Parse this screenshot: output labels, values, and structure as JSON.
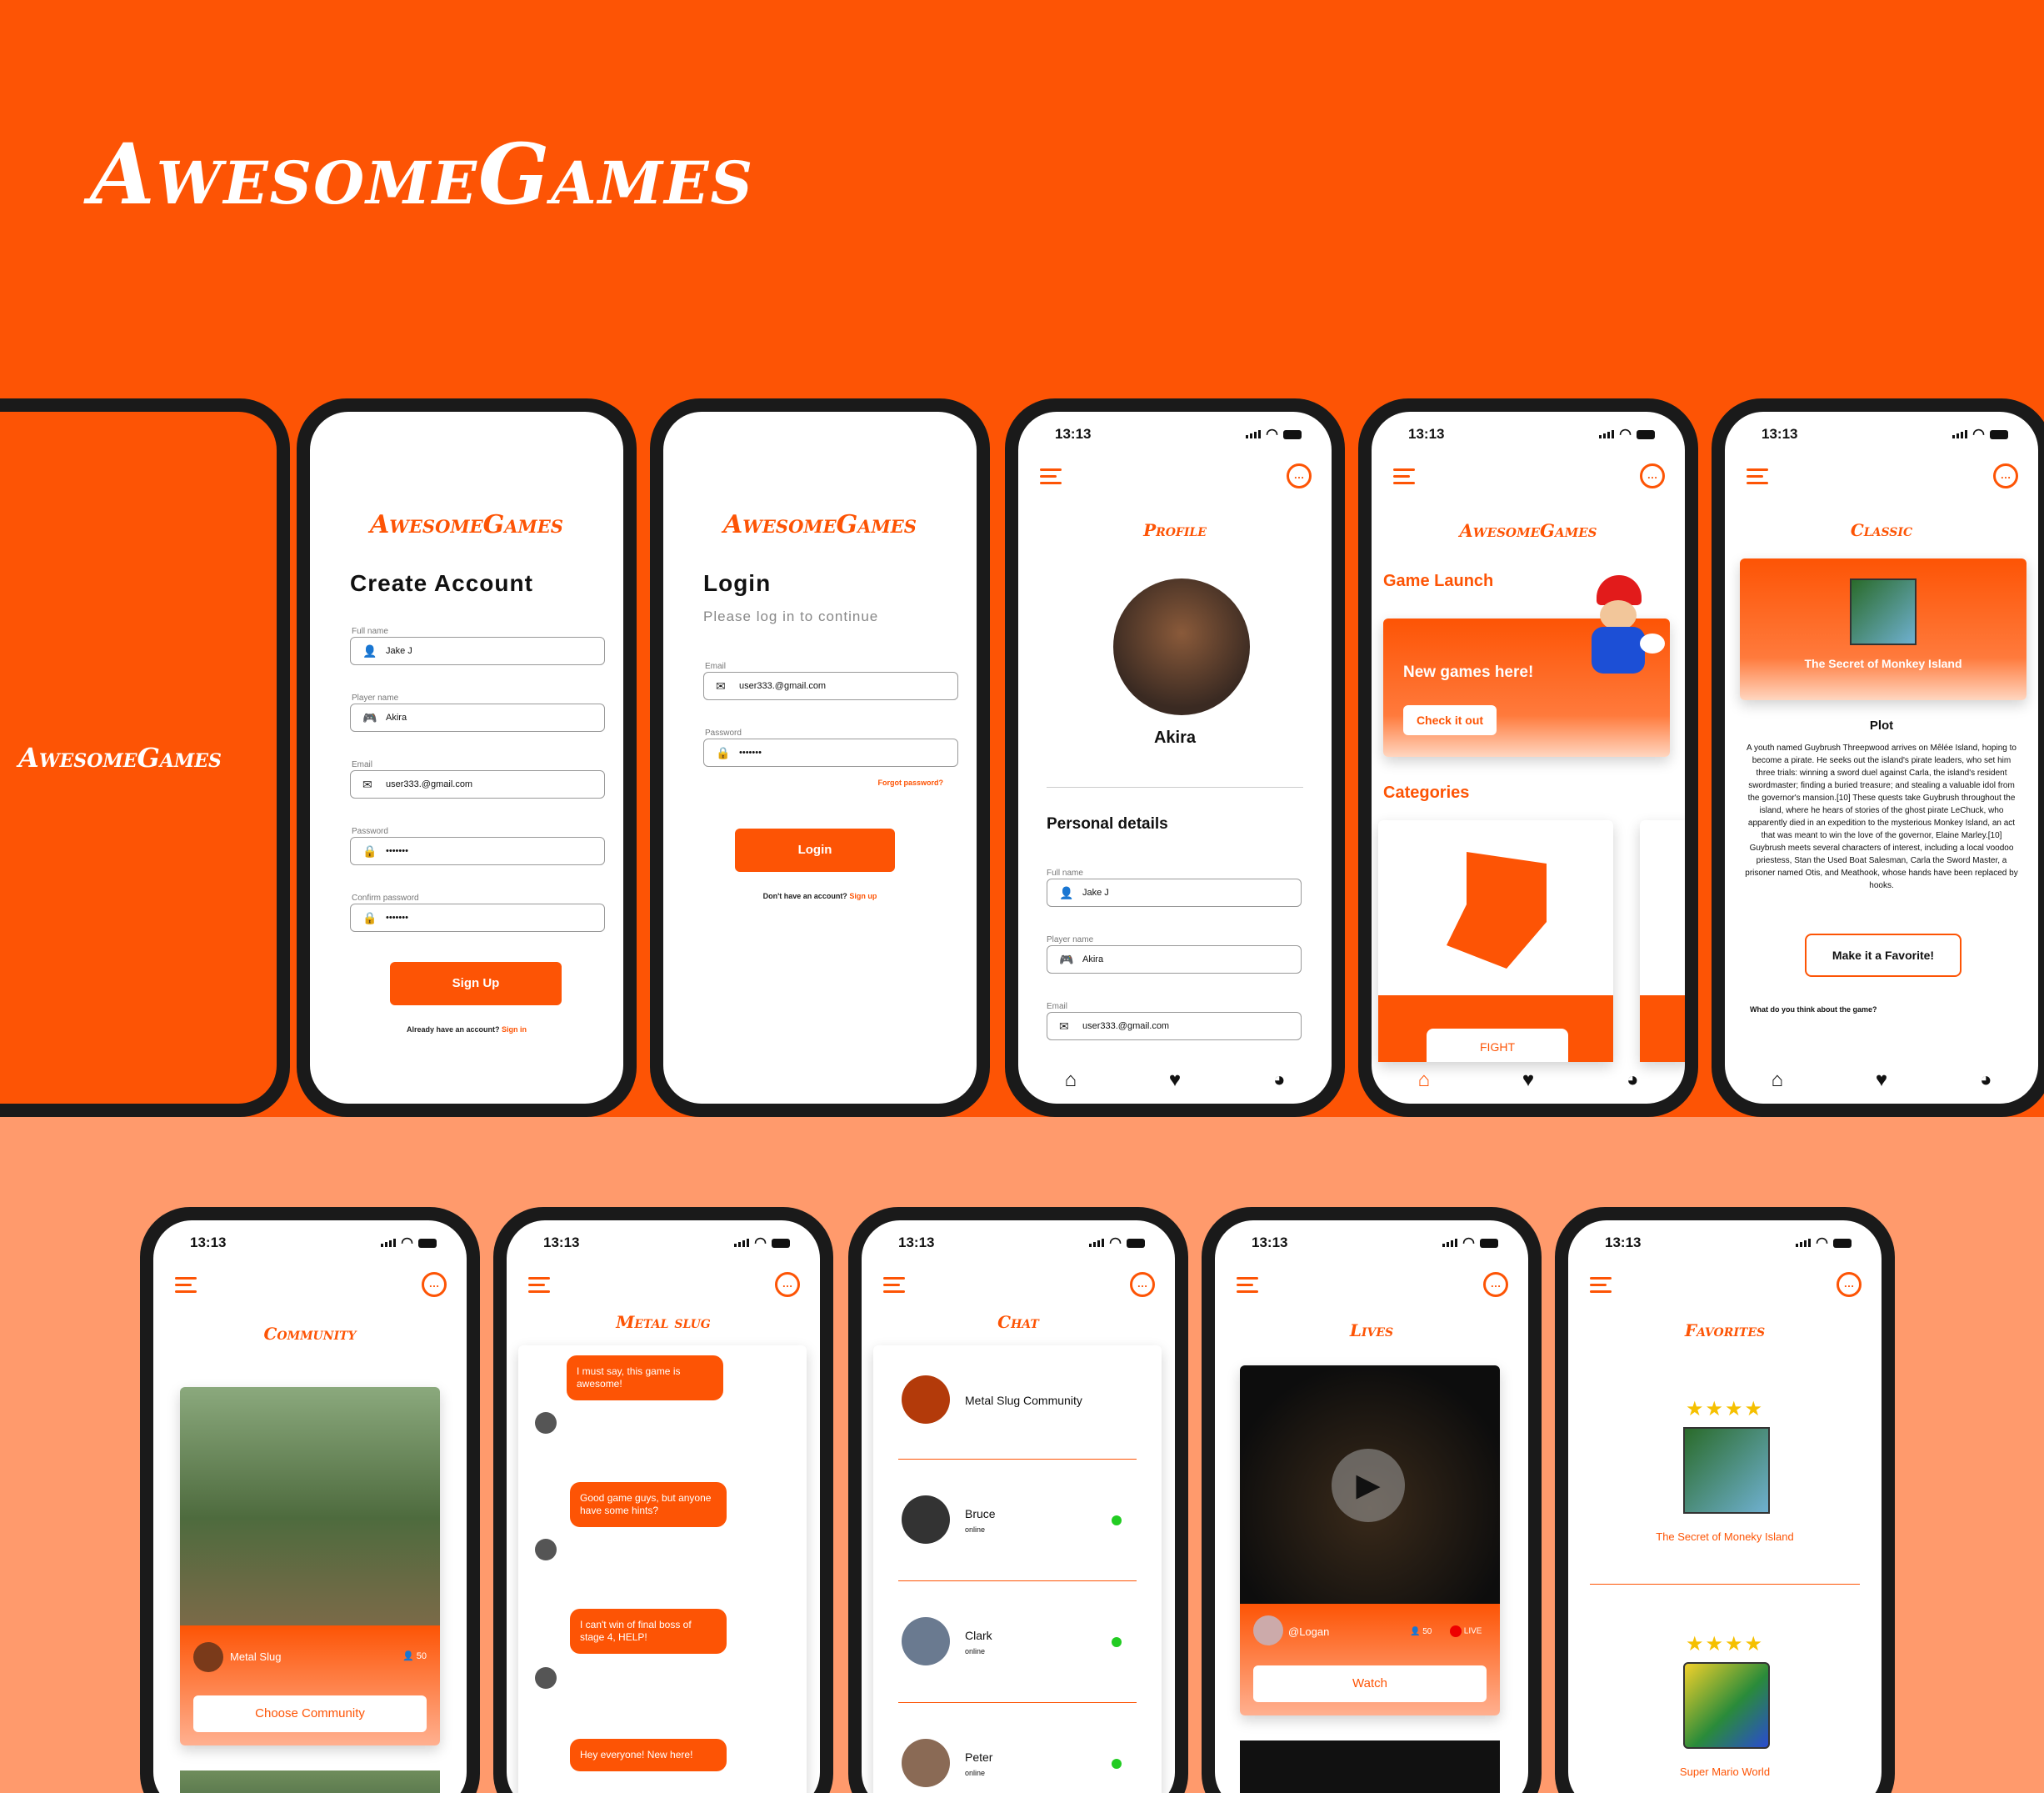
{
  "brand": "AwesomeGames",
  "status_time": "13:13",
  "splash": {
    "logo": "AwesomeGames"
  },
  "create_account": {
    "logo": "AwesomeGames",
    "title": "Create Account",
    "fields": [
      {
        "label": "Full name",
        "value": "Jake J",
        "icon": "user-icon"
      },
      {
        "label": "Player name",
        "value": "Akira",
        "icon": "gamepad-icon"
      },
      {
        "label": "Email",
        "value": "user333.@gmail.com",
        "icon": "mail-icon"
      },
      {
        "label": "Password",
        "value": "•••••••",
        "icon": "lock-icon"
      },
      {
        "label": "Confirm password",
        "value": "•••••••",
        "icon": "lock-icon"
      }
    ],
    "button": "Sign Up",
    "footer_text": "Already have an account?",
    "footer_link": "Sign in"
  },
  "login": {
    "logo": "AwesomeGames",
    "title": "Login",
    "subtitle": "Please log in to continue",
    "email_label": "Email",
    "email_value": "user333.@gmail.com",
    "password_label": "Password",
    "password_value": "•••••••",
    "forgot": "Forgot password?",
    "button": "Login",
    "footer_text": "Don't have an account?",
    "footer_link": "Sign up"
  },
  "profile": {
    "title": "Profile",
    "name": "Akira",
    "section": "Personal details",
    "fields": [
      {
        "label": "Full name",
        "value": "Jake J"
      },
      {
        "label": "Player name",
        "value": "Akira"
      },
      {
        "label": "Email",
        "value": "user333.@gmail.com"
      }
    ]
  },
  "home": {
    "logo": "AwesomeGames",
    "launch_title": "Game Launch",
    "banner_text": "New games here!",
    "banner_button": "Check it out",
    "categories_title": "Categories",
    "category_label": "FIGHT"
  },
  "classic": {
    "title": "Classic",
    "game": "The Secret of Monkey Island",
    "plot_title": "Plot",
    "plot": "A youth named Guybrush Threepwood arrives on Mêlée Island, hoping to become a pirate. He seeks out the island's pirate leaders, who set him three trials: winning a sword duel against Carla, the island's resident swordmaster; finding a buried treasure; and stealing a valuable idol from the governor's mansion.[10] These quests take Guybrush throughout the island, where he hears of stories of the ghost pirate LeChuck, who apparently died in an expedition to the mysterious Monkey Island, an act that was meant to win the love of the governor, Elaine Marley.[10] Guybrush meets several characters of interest, including a local voodoo priestess, Stan the Used Boat Salesman, Carla the Sword Master, a prisoner named Otis, and Meathook, whose hands have been replaced by hooks.",
    "button": "Make it a Favorite!",
    "question": "What do you think about the game?"
  },
  "community": {
    "title": "Community",
    "game": "Metal Slug",
    "count": "50",
    "button": "Choose Community"
  },
  "metal_slug_chat": {
    "title": "Metal slug",
    "messages": [
      "I must say, this game is awesome!",
      "Good game guys, but anyone have some hints?",
      "I can't win of final boss of stage 4, HELP!",
      "Hey everyone! New here!"
    ]
  },
  "chat": {
    "title": "Chat",
    "group": "Metal Slug Community",
    "contacts": [
      {
        "name": "Bruce",
        "status": "online"
      },
      {
        "name": "Clark",
        "status": "online"
      },
      {
        "name": "Peter",
        "status": "online"
      }
    ]
  },
  "lives": {
    "title": "Lives",
    "user": "@Logan",
    "viewers": "50",
    "live": "LIVE",
    "button": "Watch"
  },
  "favorites": {
    "title": "Favorites",
    "items": [
      {
        "name": "The Secret of Moneky Island",
        "stars": "★★★★"
      },
      {
        "name": "Super Mario World",
        "stars": "★★★★"
      }
    ]
  },
  "colors": {
    "brand": "#fd5405",
    "light": "#ff9a6c"
  }
}
